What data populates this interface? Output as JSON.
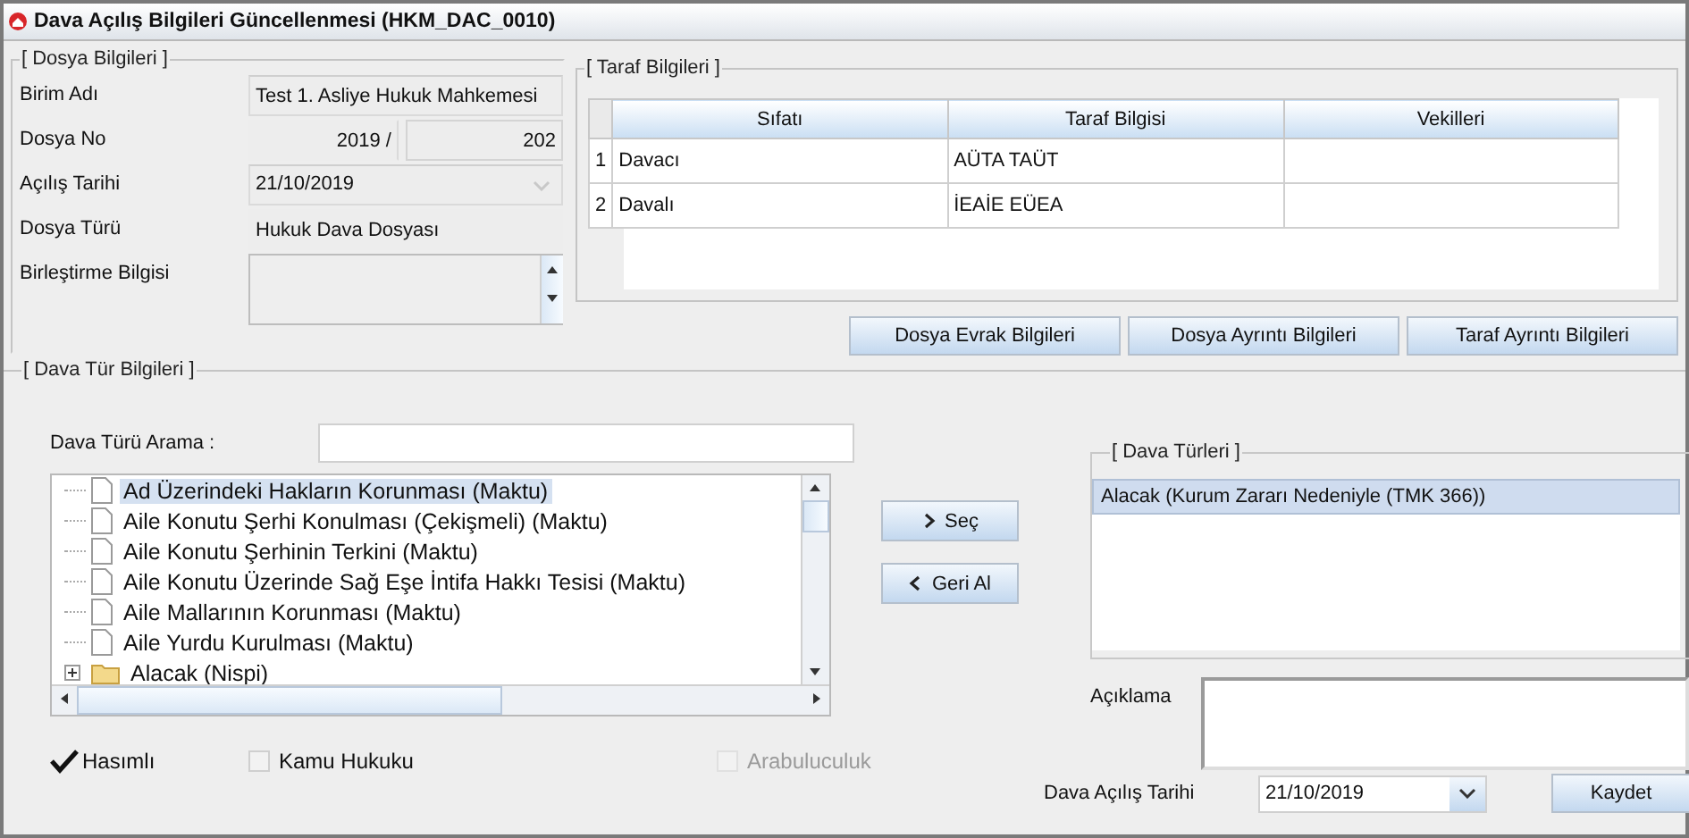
{
  "window": {
    "title": "Dava Açılış Bilgileri Güncellenmesi (HKM_DAC_0010)"
  },
  "dosya_bilgileri": {
    "legend": "[ Dosya Bilgileri ]",
    "fields": [
      {
        "label": "Birim Adı",
        "kind": "text",
        "value": "Test 1. Asliye Hukuk Mahkemesi"
      },
      {
        "label": "Dosya No",
        "kind": "split",
        "values": [
          "2019 /",
          "202"
        ]
      },
      {
        "label": "Açılış Tarihi",
        "kind": "date",
        "value": "21/10/2019",
        "disabled": true
      },
      {
        "label": "Dosya Türü",
        "kind": "plain",
        "value": "Hukuk Dava Dosyası"
      },
      {
        "label": "Birleştirme Bilgisi",
        "kind": "spin"
      }
    ]
  },
  "taraf_bilgileri": {
    "legend": "[ Taraf Bilgileri ]",
    "columns": [
      "Sıfatı",
      "Taraf Bilgisi",
      "Vekilleri"
    ],
    "rows": [
      {
        "number": "1",
        "cells": [
          "Davacı",
          "AÜTA TAÜT"
        ]
      },
      {
        "number": "2",
        "cells": [
          "Davalı",
          "İEAİE EÜEA"
        ]
      }
    ]
  },
  "taraf_buttons": [
    {
      "label": "Dosya Evrak Bilgileri"
    },
    {
      "label": "Dosya Ayrıntı Bilgileri"
    },
    {
      "label": "Taraf Ayrıntı Bilgileri"
    }
  ],
  "dava_tur": {
    "legend": "[ Dava Tür Bilgileri ]",
    "search_label": "Dava Türü Arama :",
    "tree": [
      {
        "kind": "leaf",
        "label": "Ad Üzerindeki Hakların Korunması (Maktu)",
        "selected": true
      },
      {
        "kind": "leaf",
        "label": "Aile Konutu Şerhi Konulması (Çekişmeli) (Maktu)",
        "selected": false
      },
      {
        "kind": "leaf",
        "label": "Aile Konutu Şerhinin Terkini (Maktu)",
        "selected": false
      },
      {
        "kind": "leaf",
        "label": "Aile Konutu Üzerinde Sağ Eşe İntifa Hakkı Tesisi (Maktu)",
        "selected": false
      },
      {
        "kind": "leaf",
        "label": "Aile Mallarının Korunması (Maktu)",
        "selected": false
      },
      {
        "kind": "leaf",
        "label": "Aile Yurdu Kurulması (Maktu)",
        "selected": false
      },
      {
        "kind": "folder",
        "label": "Alacak (Nispi)",
        "selected": false,
        "expanded": false
      }
    ],
    "move_buttons": [
      {
        "label": "Seç",
        "kind": "forward"
      },
      {
        "label": "Geri Al",
        "kind": "back"
      }
    ],
    "types_legend": "[ Dava Türleri ]",
    "types": [
      {
        "label": "Alacak (Kurum Zararı Nedeniyle (TMK 366))",
        "selected": true
      }
    ],
    "checkboxes": [
      {
        "label": "Hasımlı",
        "checked": true,
        "disabled": false
      },
      {
        "label": "Kamu Hukuku",
        "checked": false,
        "disabled": false
      },
      {
        "label": "Arabuluculuk",
        "checked": false,
        "disabled": true
      }
    ],
    "aciklama_label": "Açıklama",
    "date_label": "Dava Açılış Tarihi",
    "date_value": "21/10/2019",
    "save_button": {
      "label": "Kaydet"
    }
  }
}
